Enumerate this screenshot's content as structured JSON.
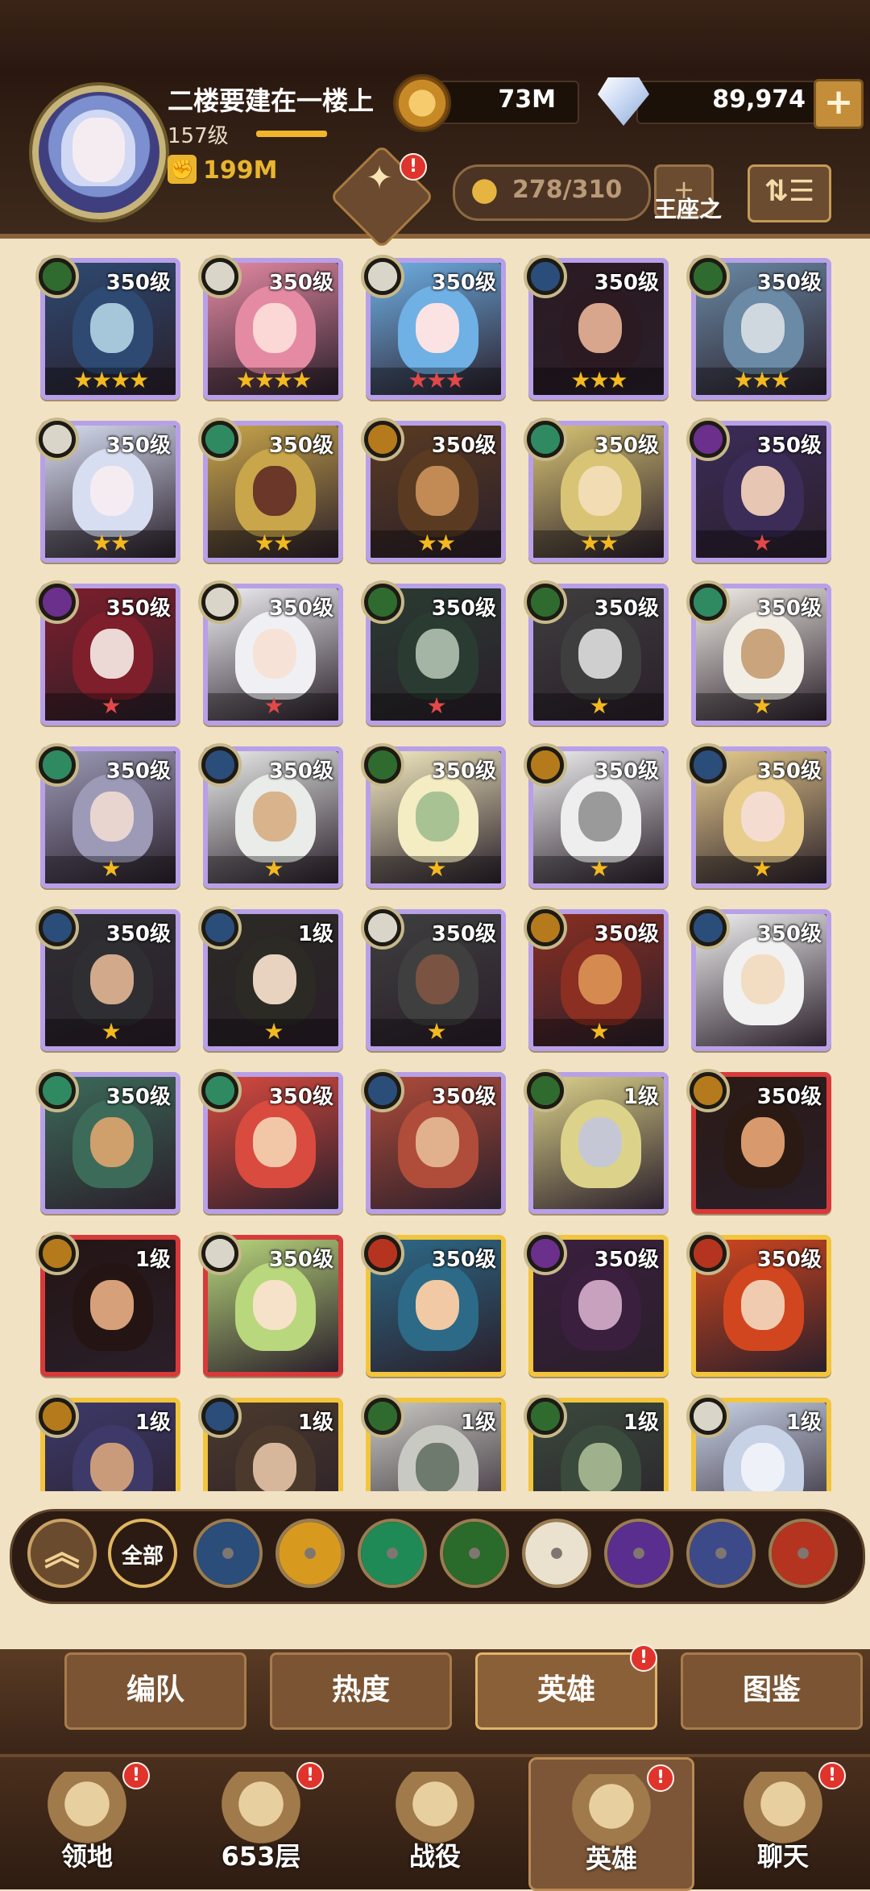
{
  "player": {
    "name": "二楼要建在一楼上",
    "level": "157级",
    "power": "199M",
    "level_progress": 0.55
  },
  "currency": {
    "gold": "73M",
    "gems": "89,974"
  },
  "header": {
    "hero_count": "278/310",
    "throne_label": "王座之",
    "trophy_badge": "!"
  },
  "heroes": [
    {
      "level": "350级",
      "stars": "★★★★",
      "star_color": "#f3b91f",
      "faction": "forest",
      "frame": "purple",
      "palette": [
        "#2e4a72",
        "#a5c7d9"
      ]
    },
    {
      "level": "350级",
      "stars": "★★★★",
      "star_color": "#f3b91f",
      "faction": "celestial",
      "frame": "purple",
      "palette": [
        "#e58aa3",
        "#fbd7d5"
      ]
    },
    {
      "level": "350级",
      "stars": "★★★",
      "star_color": "#e24848",
      "faction": "celestial",
      "frame": "purple",
      "palette": [
        "#6fb0e5",
        "#fbe2e3"
      ]
    },
    {
      "level": "350级",
      "stars": "★★★",
      "star_color": "#f3b91f",
      "faction": "lightbearer",
      "frame": "purple",
      "palette": [
        "#2b1a22",
        "#d8a58d"
      ]
    },
    {
      "level": "350级",
      "stars": "★★★",
      "star_color": "#f3b91f",
      "faction": "forest",
      "frame": "purple",
      "palette": [
        "#6a8aa5",
        "#cfd7df"
      ]
    },
    {
      "level": "350级",
      "stars": "★★",
      "star_color": "#f3b91f",
      "faction": "celestial",
      "frame": "purple",
      "palette": [
        "#d7def2",
        "#f5ecf2"
      ]
    },
    {
      "level": "350级",
      "stars": "★★",
      "star_color": "#f3b91f",
      "faction": "wilder",
      "frame": "purple",
      "palette": [
        "#c9a64a",
        "#6b3728"
      ]
    },
    {
      "level": "350级",
      "stars": "★★",
      "star_color": "#f3b91f",
      "faction": "mauler",
      "frame": "purple",
      "palette": [
        "#5a3b22",
        "#c28a55"
      ]
    },
    {
      "level": "350级",
      "stars": "★★",
      "star_color": "#f3b91f",
      "faction": "wilder",
      "frame": "purple",
      "palette": [
        "#d8c474",
        "#f1dcb4"
      ]
    },
    {
      "level": "350级",
      "stars": "★",
      "star_color": "#e24848",
      "faction": "graveborn",
      "frame": "purple",
      "palette": [
        "#3b2c58",
        "#e7c6b4"
      ]
    },
    {
      "level": "350级",
      "stars": "★",
      "star_color": "#e24848",
      "faction": "graveborn",
      "frame": "purple",
      "palette": [
        "#7e1f2b",
        "#ecd8d4"
      ]
    },
    {
      "level": "350级",
      "stars": "★",
      "star_color": "#e24848",
      "faction": "celestial",
      "frame": "purple",
      "palette": [
        "#f0f0f4",
        "#f7e2d8"
      ]
    },
    {
      "level": "350级",
      "stars": "★",
      "star_color": "#e24848",
      "faction": "forest",
      "frame": "purple",
      "palette": [
        "#2a3b32",
        "#a4b5a5"
      ]
    },
    {
      "level": "350级",
      "stars": "★",
      "star_color": "#f3b91f",
      "faction": "forest",
      "frame": "purple",
      "palette": [
        "#3f3e3e",
        "#cfcfcf"
      ]
    },
    {
      "level": "350级",
      "stars": "★",
      "star_color": "#f3b91f",
      "faction": "wilder",
      "frame": "purple",
      "palette": [
        "#f2eee6",
        "#caa47d"
      ]
    },
    {
      "level": "350级",
      "stars": "★",
      "star_color": "#f3b91f",
      "faction": "wilder",
      "frame": "purple",
      "palette": [
        "#9c9ab7",
        "#e8d5cf"
      ]
    },
    {
      "level": "350级",
      "stars": "★",
      "star_color": "#f3b91f",
      "faction": "lightbearer",
      "frame": "purple",
      "palette": [
        "#e9ece9",
        "#d8b38c"
      ]
    },
    {
      "level": "350级",
      "stars": "★",
      "star_color": "#f3b91f",
      "faction": "forest",
      "frame": "purple",
      "palette": [
        "#f4ecc2",
        "#a9c294"
      ]
    },
    {
      "level": "350级",
      "stars": "★",
      "star_color": "#f3b91f",
      "faction": "mauler",
      "frame": "purple",
      "palette": [
        "#eeeeee",
        "#9a9a9a"
      ]
    },
    {
      "level": "350级",
      "stars": "★",
      "star_color": "#f3b91f",
      "faction": "lightbearer",
      "frame": "purple",
      "palette": [
        "#e8cd8d",
        "#f4ddd0"
      ]
    },
    {
      "level": "350级",
      "stars": "★",
      "star_color": "#f3b91f",
      "faction": "lightbearer",
      "frame": "purple",
      "palette": [
        "#2f2f33",
        "#d2a98b"
      ]
    },
    {
      "level": "1级",
      "stars": "★",
      "star_color": "#f3b91f",
      "faction": "lightbearer",
      "frame": "purple",
      "palette": [
        "#2b2a24",
        "#e8d2c0"
      ]
    },
    {
      "level": "350级",
      "stars": "★",
      "star_color": "#f3b91f",
      "faction": "celestial",
      "frame": "purple",
      "palette": [
        "#3f3f3f",
        "#7a5342"
      ]
    },
    {
      "level": "350级",
      "stars": "★",
      "star_color": "#f3b91f",
      "faction": "mauler",
      "frame": "purple",
      "palette": [
        "#8a2f22",
        "#d58a4f"
      ]
    },
    {
      "level": "350级",
      "stars": "",
      "star_color": "#f3b91f",
      "faction": "lightbearer",
      "frame": "purple",
      "palette": [
        "#f1f1f1",
        "#f2dcc2"
      ]
    },
    {
      "level": "350级",
      "stars": "",
      "star_color": "#f3b91f",
      "faction": "wilder",
      "frame": "purple",
      "palette": [
        "#3c6b5a",
        "#cf9f6c"
      ]
    },
    {
      "level": "350级",
      "stars": "",
      "star_color": "#f3b91f",
      "faction": "wilder",
      "frame": "purple",
      "palette": [
        "#d94a3f",
        "#f2c7a8"
      ]
    },
    {
      "level": "350级",
      "stars": "",
      "star_color": "#f3b91f",
      "faction": "lightbearer",
      "frame": "purple",
      "palette": [
        "#b04c3a",
        "#e1b08d"
      ]
    },
    {
      "level": "1级",
      "stars": "",
      "star_color": "#f3b91f",
      "faction": "forest",
      "frame": "purple",
      "palette": [
        "#dcd28a",
        "#c5c8d4"
      ]
    },
    {
      "level": "350级",
      "stars": "",
      "star_color": "#f3b91f",
      "faction": "mauler",
      "frame": "red",
      "palette": [
        "#2b1a14",
        "#d89a6c"
      ]
    },
    {
      "level": "1级",
      "stars": "",
      "star_color": "#f3b91f",
      "faction": "mauler",
      "frame": "red",
      "palette": [
        "#241514",
        "#d6a07a"
      ]
    },
    {
      "level": "350级",
      "stars": "",
      "star_color": "#f3b91f",
      "faction": "celestial",
      "frame": "red",
      "palette": [
        "#b9d77c",
        "#f6e2c9"
      ]
    },
    {
      "level": "350级",
      "stars": "",
      "star_color": "#f3b91f",
      "faction": "hypogean",
      "frame": "gold",
      "palette": [
        "#2c6a88",
        "#f1c9a4"
      ]
    },
    {
      "level": "350级",
      "stars": "",
      "star_color": "#f3b91f",
      "faction": "graveborn",
      "frame": "gold",
      "palette": [
        "#3a1f3e",
        "#c7a1bd"
      ]
    },
    {
      "level": "350级",
      "stars": "",
      "star_color": "#f3b91f",
      "faction": "hypogean",
      "frame": "gold",
      "palette": [
        "#d1461f",
        "#f0cbb0"
      ]
    },
    {
      "level": "1级",
      "stars": "",
      "star_color": "#f3b91f",
      "faction": "mauler",
      "frame": "gold",
      "palette": [
        "#3d3a6a",
        "#c99b7a"
      ]
    },
    {
      "level": "1级",
      "stars": "",
      "star_color": "#f3b91f",
      "faction": "lightbearer",
      "frame": "gold",
      "palette": [
        "#4b3a2c",
        "#d6b79b"
      ]
    },
    {
      "level": "1级",
      "stars": "",
      "star_color": "#f3b91f",
      "faction": "forest",
      "frame": "gold",
      "palette": [
        "#c9c9c3",
        "#6f7a6f"
      ]
    },
    {
      "level": "1级",
      "stars": "",
      "star_color": "#f3b91f",
      "faction": "forest",
      "frame": "gold",
      "palette": [
        "#3a4a3c",
        "#9fb08d"
      ]
    },
    {
      "level": "1级",
      "stars": "",
      "star_color": "#f3b91f",
      "faction": "celestial",
      "frame": "gold",
      "palette": [
        "#c7d2e6",
        "#eef1f8"
      ]
    }
  ],
  "faction_colors": {
    "forest": "#2f6b2e",
    "celestial": "#d9d5c9",
    "lightbearer": "#2b4d7a",
    "wilder": "#2f8a62",
    "mauler": "#b57a1c",
    "graveborn": "#6b2f8c",
    "hypogean": "#b5341f"
  },
  "filters": {
    "all_label": "全部",
    "items": [
      {
        "name": "lightbearer-filter",
        "color": "#2b4d7a",
        "icon": "compass-star-icon"
      },
      {
        "name": "mauler-filter",
        "color": "#d79a1f",
        "icon": "mauler-emblem-icon"
      },
      {
        "name": "wilder-filter",
        "color": "#1f8a55",
        "icon": "leaf-emblem-icon"
      },
      {
        "name": "graveborn-filter",
        "color": "#2a6a2a",
        "icon": "eye-emblem-icon"
      },
      {
        "name": "celestial-filter",
        "color": "#eae2cf",
        "icon": "white-star-icon"
      },
      {
        "name": "graveborn2-filter",
        "color": "#5a2e8f",
        "icon": "purple-crystal-icon"
      },
      {
        "name": "dimensional-filter",
        "color": "#3d4a8a",
        "icon": "ring-emblem-icon"
      },
      {
        "name": "hypogean-filter",
        "color": "#b5341f",
        "icon": "flame-emblem-icon"
      }
    ]
  },
  "sub_tabs": [
    "编队",
    "热度",
    "英雄",
    "图鉴"
  ],
  "nav": [
    {
      "label": "领地",
      "icon": "castle-icon",
      "badge": "!"
    },
    {
      "label": "653层",
      "icon": "crossed-swords-icon",
      "badge": "!"
    },
    {
      "label": "战役",
      "icon": "sword-emblem-icon",
      "badge": ""
    },
    {
      "label": "英雄",
      "icon": "helmet-icon",
      "badge": "!"
    },
    {
      "label": "聊天",
      "icon": "chat-icon",
      "badge": "!"
    }
  ]
}
